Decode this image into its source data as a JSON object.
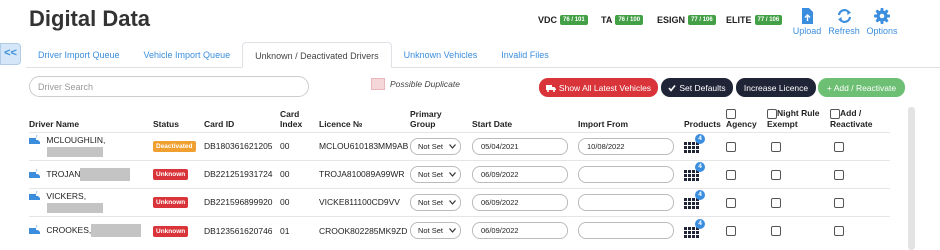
{
  "header": {
    "title": "Digital Data"
  },
  "counters": [
    {
      "label": "VDC",
      "value": "76 / 101"
    },
    {
      "label": "TA",
      "value": "76 / 100"
    },
    {
      "label": "ESIGN",
      "value": "77 / 106"
    },
    {
      "label": "ELITE",
      "value": "77 / 106"
    }
  ],
  "top_actions": {
    "upload": "Upload",
    "refresh": "Refresh",
    "options": "Options"
  },
  "collapse_label": "<<",
  "tabs": [
    {
      "label": "Driver Import Queue"
    },
    {
      "label": "Vehicle Import Queue"
    },
    {
      "label": "Unknown / Deactivated Drivers"
    },
    {
      "label": "Unknown Vehicles"
    },
    {
      "label": "Invalid Files"
    }
  ],
  "search": {
    "placeholder": "Driver Search"
  },
  "legend": {
    "possible_duplicate": "Possible Duplicate"
  },
  "buttons": {
    "show_all": "Show All Latest Vehicles",
    "set_defaults": "Set Defaults",
    "increase_licence": "Increase Licence",
    "add_reactivate": "+ Add / Reactivate"
  },
  "columns": {
    "driver_name": "Driver Name",
    "status": "Status",
    "card_id": "Card ID",
    "card_index_1": "Card",
    "card_index_2": "Index",
    "licence": "Licence №",
    "primary_group_1": "Primary",
    "primary_group_2": "Group",
    "start_date": "Start Date",
    "import_from": "Import From",
    "products": "Products",
    "agency": "Agency",
    "night_rule_1": "Night Rule",
    "night_rule_2": "Exempt",
    "add_reactivate_1": "Add /",
    "add_reactivate_2": "Reactivate"
  },
  "rows": [
    {
      "name": "MCLOUGHLIN,",
      "status": "Deactivated",
      "card_id": "DB180361621205",
      "card_index": "00",
      "licence": "MCLOU610183MM9AB",
      "group": "Not Set",
      "start_date": "05/04/2021",
      "import_from": "10/08/2022",
      "products": "4"
    },
    {
      "name": "TROJAN",
      "status": "Unknown",
      "card_id": "DB221251931724",
      "card_index": "00",
      "licence": "TROJA810089A99WR",
      "group": "Not Set",
      "start_date": "06/09/2022",
      "import_from": "",
      "products": "4"
    },
    {
      "name": "VICKERS,",
      "status": "Unknown",
      "card_id": "DB221596899920",
      "card_index": "00",
      "licence": "VICKE811100CD9VV",
      "group": "Not Set",
      "start_date": "06/09/2022",
      "import_from": "",
      "products": "4"
    },
    {
      "name": "CROOKES,",
      "status": "Unknown",
      "card_id": "DB123561620746",
      "card_index": "01",
      "licence": "CROOK802285MK9ZD",
      "group": "Not Set",
      "start_date": "06/09/2022",
      "import_from": "",
      "products": "4"
    }
  ],
  "colors": {
    "accent": "#3b8ede",
    "deactivated": "#f0a030",
    "unknown": "#d9343a",
    "counter": "#43a047",
    "dark_button": "#1f2437",
    "green_button": "#6dbf73"
  }
}
